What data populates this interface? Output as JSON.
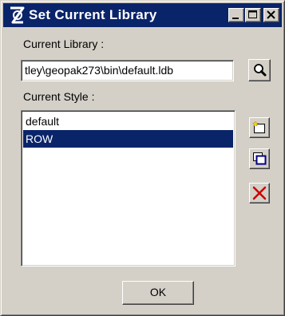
{
  "window": {
    "title": "Set Current Library",
    "title_bar_color": "#0a246a",
    "face_color": "#d4d0c8"
  },
  "library": {
    "label": "Current Library :",
    "value": "tley\\geopak273\\bin\\default.ldb",
    "browse_icon": "magnifier-icon"
  },
  "style": {
    "label": "Current Style :",
    "items": [
      "default",
      "ROW"
    ],
    "selected": "ROW",
    "selection_color": "#0a246a"
  },
  "tools": {
    "new_icon": "new-style-icon",
    "copy_icon": "copy-style-icon",
    "delete_icon": "delete-style-icon"
  },
  "footer": {
    "ok_label": "OK"
  }
}
